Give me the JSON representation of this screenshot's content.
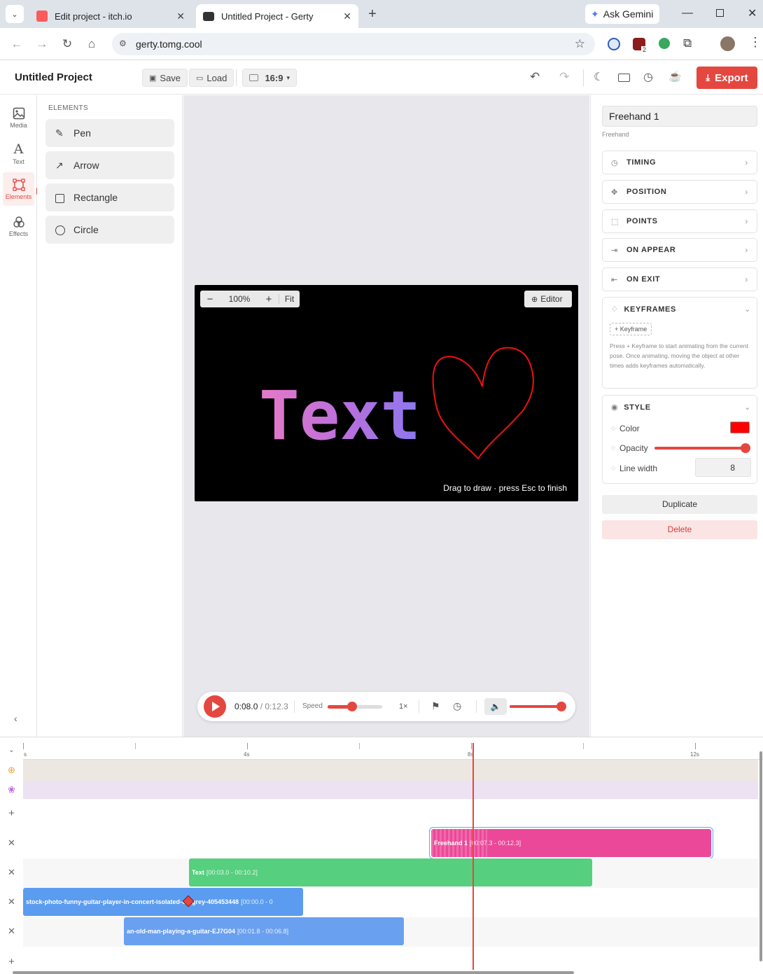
{
  "browser": {
    "tabs": [
      {
        "title": "Edit project - itch.io",
        "active": false
      },
      {
        "title": "Untitled Project - Gerty",
        "active": true
      }
    ],
    "new_tab": "+",
    "gemini": "Ask Gemini",
    "url": "gerty.tomg.cool",
    "extension_badge": "2"
  },
  "header": {
    "project_title": "Untitled Project",
    "save": "Save",
    "load": "Load",
    "aspect": "16:9",
    "export": "Export"
  },
  "rail": [
    {
      "label": "Media",
      "icon": "media-icon"
    },
    {
      "label": "Text",
      "icon": "text-icon"
    },
    {
      "label": "Elements",
      "icon": "elements-icon",
      "active": true
    },
    {
      "label": "Effects",
      "icon": "effects-icon"
    }
  ],
  "elements_panel": {
    "heading": "ELEMENTS",
    "items": [
      {
        "label": "Pen",
        "icon": "pen-icon"
      },
      {
        "label": "Arrow",
        "icon": "arrow-icon"
      },
      {
        "label": "Rectangle",
        "icon": "rectangle-icon"
      },
      {
        "label": "Circle",
        "icon": "circle-icon"
      }
    ]
  },
  "preview": {
    "zoom": "100%",
    "fit": "Fit",
    "editor": "Editor",
    "canvas_text": "Text",
    "hint": "Drag to draw · press Esc to finish"
  },
  "playback": {
    "current": "0:08.0",
    "total": "/ 0:12.3",
    "speed_label": "Speed",
    "speed_value": "1×",
    "speed_fraction": 0.45,
    "volume_fraction": 0.98
  },
  "inspector": {
    "name": "Freehand 1",
    "type": "Freehand",
    "sections": [
      "TIMING",
      "POSITION",
      "POINTS",
      "ON APPEAR",
      "ON EXIT"
    ],
    "keyframes": {
      "title": "KEYFRAMES",
      "button": "+ Keyframe",
      "help": "Press + Keyframe to start animating from the current pose. Once animating, moving the object at other times adds keyframes automatically."
    },
    "style": {
      "title": "STYLE",
      "color_label": "Color",
      "color_value": "#ff0000",
      "opacity_label": "Opacity",
      "opacity_fraction": 1.0,
      "line_width_label": "Line width",
      "line_width": "8"
    },
    "duplicate": "Duplicate",
    "delete": "Delete"
  },
  "timeline": {
    "ticks": [
      "s",
      "4s",
      "8s",
      "12s"
    ],
    "clips": [
      {
        "name": "Freehand 1",
        "range": "[00:07.3 - 00:12.3]",
        "color": "#ec4899"
      },
      {
        "name": "Text",
        "range": "[00:03.0 - 00:10.2]",
        "color": "#56cf7e"
      },
      {
        "name": "stock-photo-funny-guitar-player-in-concert-isolated-on-grey-405453448",
        "range": "[00:00.0 - 0",
        "color": "#5b9cf0"
      },
      {
        "name": "an-old-man-playing-a-guitar-EJ7G04",
        "range": "[00:01.8 - 00:06.8]",
        "color": "#6aa0f0"
      }
    ]
  }
}
